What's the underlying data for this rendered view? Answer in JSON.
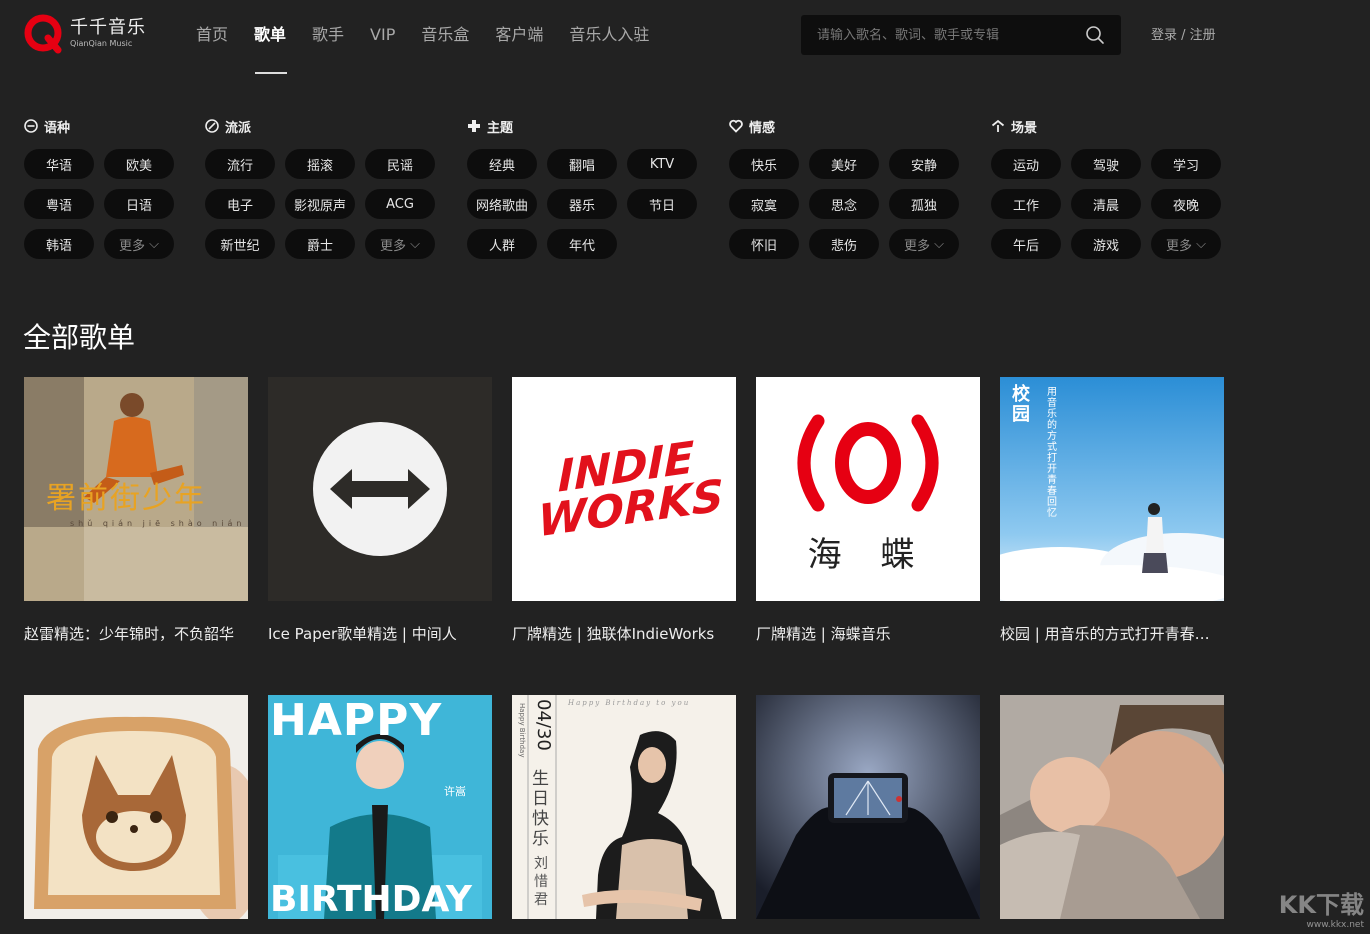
{
  "header": {
    "logo_cn": "千千音乐",
    "logo_en": "QianQian Music",
    "nav": [
      {
        "label": "首页",
        "active": false
      },
      {
        "label": "歌单",
        "active": true
      },
      {
        "label": "歌手",
        "active": false
      },
      {
        "label": "VIP",
        "active": false
      },
      {
        "label": "音乐盒",
        "active": false
      },
      {
        "label": "客户端",
        "active": false
      },
      {
        "label": "音乐人入驻",
        "active": false
      }
    ],
    "search_placeholder": "请输入歌名、歌词、歌手或专辑",
    "login": "登录 / 注册"
  },
  "categories": [
    {
      "title": "语种",
      "icon": "language-icon",
      "tags": [
        "华语",
        "欧美",
        "粤语",
        "日语",
        "韩语",
        "更多"
      ]
    },
    {
      "title": "流派",
      "icon": "genre-icon",
      "tags": [
        "流行",
        "摇滚",
        "民谣",
        "电子",
        "影视原声",
        "ACG",
        "新世纪",
        "爵士",
        "更多"
      ]
    },
    {
      "title": "主题",
      "icon": "theme-icon",
      "tags": [
        "经典",
        "翻唱",
        "KTV",
        "网络歌曲",
        "器乐",
        "节日",
        "人群",
        "年代"
      ]
    },
    {
      "title": "情感",
      "icon": "heart-icon",
      "tags": [
        "快乐",
        "美好",
        "安静",
        "寂寞",
        "思念",
        "孤独",
        "怀旧",
        "悲伤",
        "更多"
      ]
    },
    {
      "title": "场景",
      "icon": "scene-icon",
      "tags": [
        "运动",
        "驾驶",
        "学习",
        "工作",
        "清晨",
        "夜晚",
        "午后",
        "游戏",
        "更多"
      ]
    }
  ],
  "section_title": "全部歌单",
  "playlists": [
    {
      "title": "赵雷精选：少年锦时，不负韶华",
      "cover_text": "署前街少年",
      "cover_pinyin": "shǔ qián jiē shào nián"
    },
    {
      "title": "Ice Paper歌单精选 | 中间人"
    },
    {
      "title": "厂牌精选 | 独联体IndieWorks",
      "cover_text": "INDIE WORKS"
    },
    {
      "title": "厂牌精选 | 海蝶音乐",
      "cover_text": "海 蝶"
    },
    {
      "title": "校园 | 用音乐的方式打开青春回忆",
      "cover_text": "校园",
      "cover_sub": "用音乐的方式打开青春回忆"
    },
    {
      "title": ""
    },
    {
      "title": "",
      "cover_text_top": "HAPPY",
      "cover_text_bottom": "BIRTHDAY",
      "cover_name": "许嵩"
    },
    {
      "title": "",
      "cover_date": "04/30",
      "cover_text": "生日快乐",
      "cover_name": "刘惜君",
      "cover_script": "Happy Birthday to you",
      "cover_side": "Happy Birthday"
    },
    {
      "title": ""
    },
    {
      "title": ""
    }
  ],
  "watermark": {
    "text": "KK下载",
    "url": "www.kkx.net"
  },
  "colors": {
    "background": "#222222",
    "tag_bg": "#0d0d0d",
    "brand_red": "#e60012"
  }
}
